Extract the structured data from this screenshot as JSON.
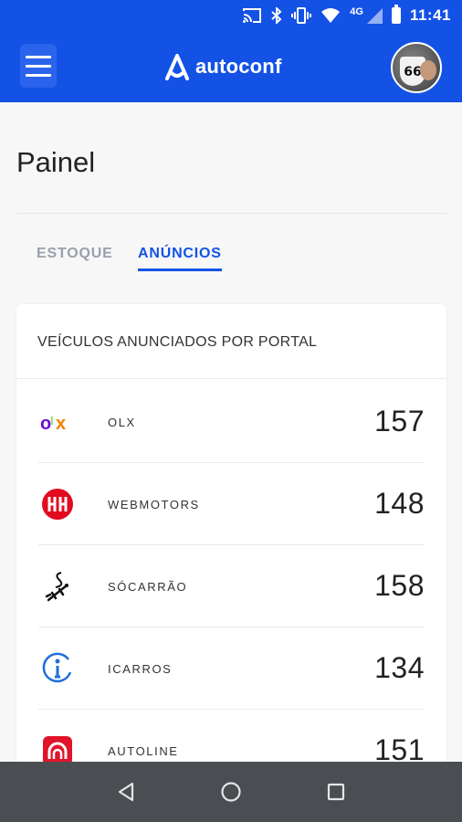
{
  "status_bar": {
    "time": "11:41",
    "network": "4G"
  },
  "app_bar": {
    "logo_text": "autoconf"
  },
  "page": {
    "title": "Painel"
  },
  "tabs": [
    {
      "label": "ESTOQUE",
      "active": false
    },
    {
      "label": "ANÚNCIOS",
      "active": true
    }
  ],
  "card": {
    "title": "VEÍCULOS ANUNCIADOS POR PORTAL",
    "rows": [
      {
        "name": "OLX",
        "count": "157",
        "icon": "olx-logo"
      },
      {
        "name": "WEBMOTORS",
        "count": "148",
        "icon": "webmotors-logo"
      },
      {
        "name": "SÓCARRÃO",
        "count": "158",
        "icon": "socarrao-logo"
      },
      {
        "name": "ICARROS",
        "count": "134",
        "icon": "icarros-logo"
      },
      {
        "name": "AUTOLINE",
        "count": "151",
        "icon": "autoline-logo"
      }
    ]
  },
  "colors": {
    "primary": "#1452e6",
    "tab_inactive": "#9aa0aa",
    "nav_bar": "#4a4d52"
  }
}
